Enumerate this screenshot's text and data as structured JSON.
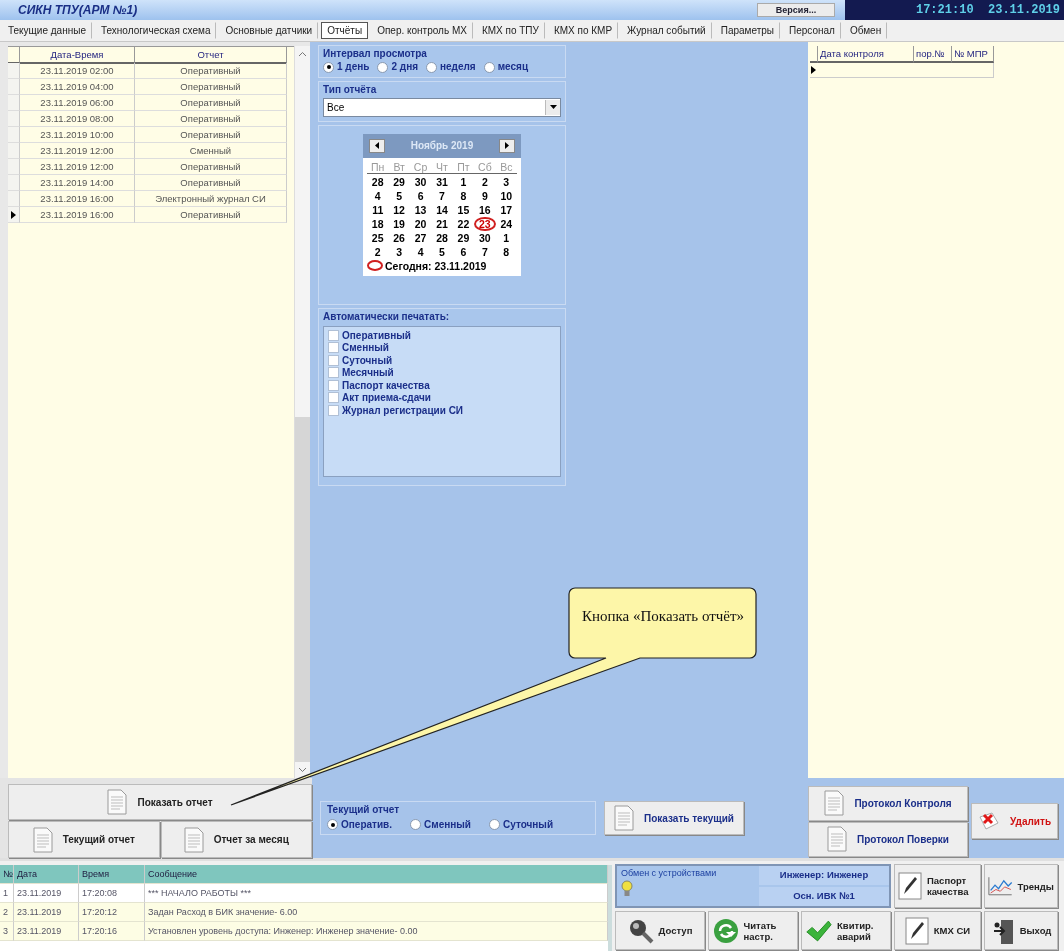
{
  "window": {
    "title": "СИКН ТПУ(АРМ №1)",
    "version_button": "Версия...",
    "clock": "17:21:10  23.11.2019"
  },
  "tabs": [
    {
      "label": "Текущие данные",
      "selected": false
    },
    {
      "label": "Технологическая схема",
      "selected": false
    },
    {
      "label": "Основные датчики",
      "selected": false
    },
    {
      "label": "Отчёты",
      "selected": true
    },
    {
      "label": "Опер. контроль МХ",
      "selected": false
    },
    {
      "label": "КМХ по ТПУ",
      "selected": false
    },
    {
      "label": "КМХ по КМР",
      "selected": false
    },
    {
      "label": "Журнал событий",
      "selected": false
    },
    {
      "label": "Параметры",
      "selected": false
    },
    {
      "label": "Персонал",
      "selected": false
    },
    {
      "label": "Обмен",
      "selected": false
    }
  ],
  "reports_table": {
    "columns": [
      "Дата-Время",
      "Отчет"
    ],
    "rows": [
      {
        "datetime": "23.11.2019 02:00",
        "report": "Оперативный",
        "current": false
      },
      {
        "datetime": "23.11.2019 04:00",
        "report": "Оперативный",
        "current": false
      },
      {
        "datetime": "23.11.2019 06:00",
        "report": "Оперативный",
        "current": false
      },
      {
        "datetime": "23.11.2019 08:00",
        "report": "Оперативный",
        "current": false
      },
      {
        "datetime": "23.11.2019 10:00",
        "report": "Оперативный",
        "current": false
      },
      {
        "datetime": "23.11.2019 12:00",
        "report": "Сменный",
        "current": false
      },
      {
        "datetime": "23.11.2019 12:00",
        "report": "Оперативный",
        "current": false
      },
      {
        "datetime": "23.11.2019 14:00",
        "report": "Оперативный",
        "current": false
      },
      {
        "datetime": "23.11.2019 16:00",
        "report": "Электронный журнал СИ",
        "current": false
      },
      {
        "datetime": "23.11.2019 16:00",
        "report": "Оперативный",
        "current": true
      }
    ]
  },
  "view_interval": {
    "title": "Интервал просмотра",
    "options": [
      {
        "label": "1 день",
        "selected": true
      },
      {
        "label": "2 дня",
        "selected": false
      },
      {
        "label": "неделя",
        "selected": false
      },
      {
        "label": "месяц",
        "selected": false
      }
    ]
  },
  "report_type": {
    "title": "Тип отчёта",
    "value": "Все"
  },
  "calendar": {
    "month": "Ноябрь 2019",
    "weekdays": [
      "Пн",
      "Вт",
      "Ср",
      "Чт",
      "Пт",
      "Сб",
      "Вс"
    ],
    "weeks": [
      [
        {
          "day": "28",
          "selected": false
        },
        {
          "day": "29",
          "selected": false
        },
        {
          "day": "30",
          "selected": false
        },
        {
          "day": "31",
          "selected": false
        },
        {
          "day": "1",
          "selected": false
        },
        {
          "day": "2",
          "selected": false
        },
        {
          "day": "3",
          "selected": false
        }
      ],
      [
        {
          "day": "4",
          "selected": false
        },
        {
          "day": "5",
          "selected": false
        },
        {
          "day": "6",
          "selected": false
        },
        {
          "day": "7",
          "selected": false
        },
        {
          "day": "8",
          "selected": false
        },
        {
          "day": "9",
          "selected": false
        },
        {
          "day": "10",
          "selected": false
        }
      ],
      [
        {
          "day": "11",
          "selected": false
        },
        {
          "day": "12",
          "selected": false
        },
        {
          "day": "13",
          "selected": false
        },
        {
          "day": "14",
          "selected": false
        },
        {
          "day": "15",
          "selected": false
        },
        {
          "day": "16",
          "selected": false
        },
        {
          "day": "17",
          "selected": false
        }
      ],
      [
        {
          "day": "18",
          "selected": false
        },
        {
          "day": "19",
          "selected": false
        },
        {
          "day": "20",
          "selected": false
        },
        {
          "day": "21",
          "selected": false
        },
        {
          "day": "22",
          "selected": false
        },
        {
          "day": "23",
          "selected": true
        },
        {
          "day": "24",
          "selected": false
        }
      ],
      [
        {
          "day": "25",
          "selected": false
        },
        {
          "day": "26",
          "selected": false
        },
        {
          "day": "27",
          "selected": false
        },
        {
          "day": "28",
          "selected": false
        },
        {
          "day": "29",
          "selected": false
        },
        {
          "day": "30",
          "selected": false
        },
        {
          "day": "1",
          "selected": false
        }
      ],
      [
        {
          "day": "2",
          "selected": false
        },
        {
          "day": "3",
          "selected": false
        },
        {
          "day": "4",
          "selected": false
        },
        {
          "day": "5",
          "selected": false
        },
        {
          "day": "6",
          "selected": false
        },
        {
          "day": "7",
          "selected": false
        },
        {
          "day": "8",
          "selected": false
        }
      ]
    ],
    "today": "Сегодня: 23.11.2019"
  },
  "auto_print": {
    "title": "Автоматически печатать:",
    "items": [
      {
        "label": "Оперативный",
        "checked": false
      },
      {
        "label": "Сменный",
        "checked": false
      },
      {
        "label": "Суточный",
        "checked": false
      },
      {
        "label": "Месячный",
        "checked": false
      },
      {
        "label": "Паспорт качества",
        "checked": false
      },
      {
        "label": "Акт приема-сдачи",
        "checked": false
      },
      {
        "label": "Журнал регистрации СИ",
        "checked": false
      }
    ]
  },
  "control_table": {
    "columns": [
      "Дата контроля",
      "пор.№",
      "№ МПР"
    ]
  },
  "report_buttons": [
    "Показать отчет",
    "Текущий отчет",
    "Отчет за месяц"
  ],
  "current_report": {
    "title": "Текущий отчет",
    "options": [
      {
        "label": "Оператив.",
        "selected": true
      },
      {
        "label": "Сменный",
        "selected": false
      },
      {
        "label": "Суточный",
        "selected": false
      }
    ]
  },
  "show_current_button": "Показать текущий",
  "protocol_buttons": [
    "Протокол Контроля",
    "Протокол Поверки"
  ],
  "delete_button": "Удалить",
  "log": {
    "columns": [
      "№",
      "Дата",
      "Время",
      "Сообщение"
    ],
    "rows": [
      {
        "no": "1",
        "date": "23.11.2019",
        "time": "17:20:08",
        "message": "*** НАЧАЛО РАБОТЫ ***"
      },
      {
        "no": "2",
        "date": "23.11.2019",
        "time": "17:20:12",
        "message": "Задан Расход в БИК значение- 6.00"
      },
      {
        "no": "3",
        "date": "23.11.2019",
        "time": "17:20:16",
        "message": "Установлен уровень доступа: Инженер: Инженер значение- 0.00"
      }
    ]
  },
  "status": {
    "exchange": "Обмен с устройствами",
    "user": "Инженер: Инженер",
    "ivk": "Осн. ИВК №1"
  },
  "toolbar": [
    {
      "kind": "passport",
      "label": "Паспорт качества"
    },
    {
      "kind": "trends",
      "label": "Тренды"
    },
    {
      "kind": "access",
      "label": "Доступ"
    },
    {
      "kind": "read",
      "label": "Читать настр."
    },
    {
      "kind": "ack",
      "label": "Квитир. аварий"
    },
    {
      "kind": "kmx",
      "label": "КМХ СИ"
    },
    {
      "kind": "exit",
      "label": "Выход"
    }
  ],
  "callout": {
    "text": "Кнопка «Показать отчёт»"
  }
}
